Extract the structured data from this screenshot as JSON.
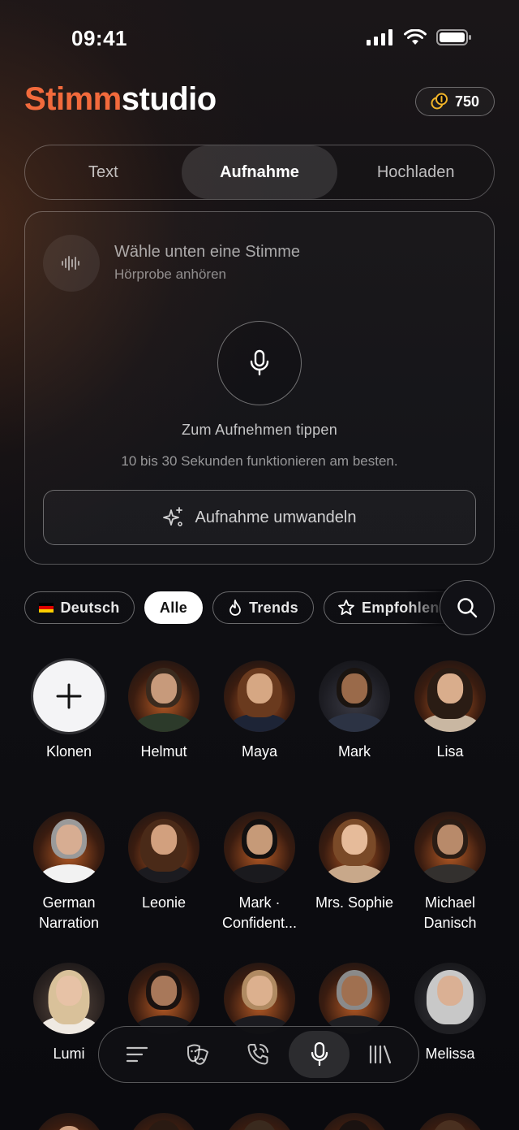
{
  "status_bar": {
    "time": "09:41"
  },
  "header": {
    "logo_part1": "Stimm",
    "logo_part2": "studio",
    "credits": "750",
    "credits_icon": "coins-icon"
  },
  "tabs": [
    {
      "label": "Text",
      "active": false
    },
    {
      "label": "Aufnahme",
      "active": true
    },
    {
      "label": "Hochladen",
      "active": false
    }
  ],
  "record_card": {
    "title": "Wähle unten eine Stimme",
    "subtitle": "Hörprobe anhören",
    "tap_label": "Zum Aufnehmen tippen",
    "hint": "10 bis 30 Sekunden funktionieren am besten.",
    "convert_label": "Aufnahme umwandeln"
  },
  "filters": [
    {
      "label": "Deutsch",
      "icon": "german-flag-icon",
      "active": false
    },
    {
      "label": "Alle",
      "icon": "",
      "active": true
    },
    {
      "label": "Trends",
      "icon": "flame-icon",
      "active": false
    },
    {
      "label": "Empfohlen",
      "icon": "star-icon",
      "active": false
    }
  ],
  "voices": [
    {
      "name": "Klonen"
    },
    {
      "name": "Helmut"
    },
    {
      "name": "Maya"
    },
    {
      "name": "Mark"
    },
    {
      "name": "Lisa"
    },
    {
      "name": "German\nNarration"
    },
    {
      "name": "Leonie"
    },
    {
      "name": "Mark ·\nConfident..."
    },
    {
      "name": "Mrs. Sophie"
    },
    {
      "name": "Michael\nDanisch"
    },
    {
      "name": "Lumi"
    },
    {
      "name": ""
    },
    {
      "name": ""
    },
    {
      "name": ""
    },
    {
      "name": "Melissa"
    }
  ],
  "bottom_nav": [
    {
      "icon": "list-icon",
      "active": false
    },
    {
      "icon": "theater-masks-icon",
      "active": false
    },
    {
      "icon": "phone-call-icon",
      "active": false
    },
    {
      "icon": "microphone-icon",
      "active": true
    },
    {
      "icon": "library-icon",
      "active": false
    }
  ]
}
